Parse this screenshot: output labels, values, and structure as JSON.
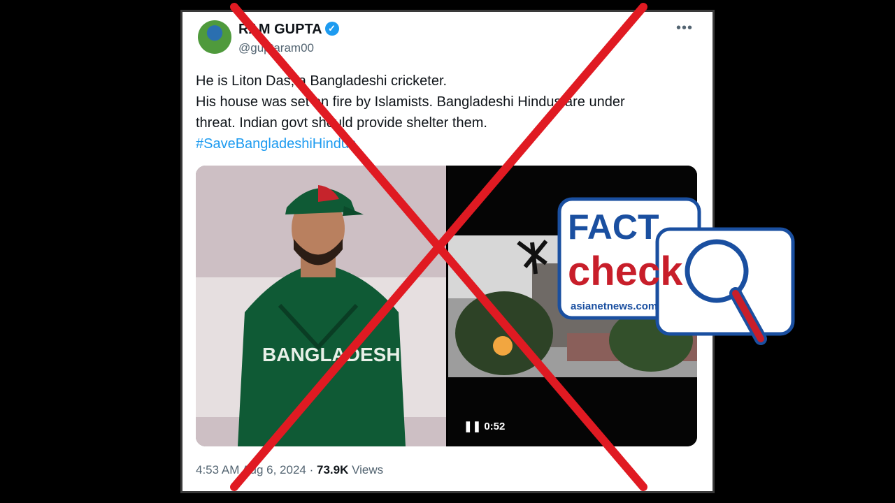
{
  "tweet": {
    "author_name": "RAM GUPTA",
    "verified_badge": "verified-icon",
    "handle": "@guptaram00",
    "more_label": "•••",
    "text_lines": [
      "He is Liton Das, a Bangladeshi cricketer.",
      "His house was set on fire by Islamists. Bangladeshi  Hindus are under",
      "threat. Indian govt should provide shelter them."
    ],
    "hashtag": "#SaveBangladeshiHindus",
    "jersey_text": "BANGLADESH",
    "video_duration": "0:52",
    "time": "4:53 AM",
    "date": "Aug 6, 2024",
    "separator": "·",
    "views_count": "73.9K",
    "views_label": "Views"
  },
  "overlay": {
    "cross_color": "#e01a22",
    "fact_check": {
      "line1": "FACT",
      "line2": "check",
      "brand": "asianetnews.com",
      "primary_color": "#1a4fa0",
      "accent_color": "#c81e2a"
    }
  }
}
